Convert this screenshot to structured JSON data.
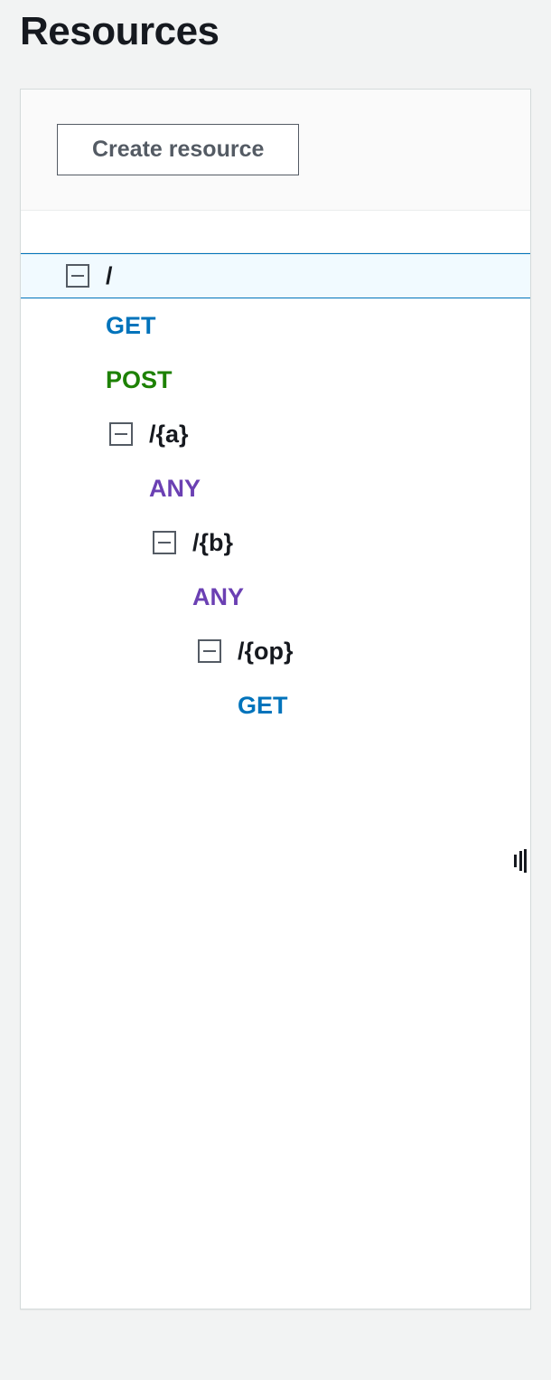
{
  "title": "Resources",
  "buttons": {
    "create_resource": "Create resource"
  },
  "tree": {
    "root": {
      "path": "/",
      "methods": [
        "GET",
        "POST"
      ],
      "children": {
        "a": {
          "path": "/{a}",
          "methods": [
            "ANY"
          ],
          "children": {
            "b": {
              "path": "/{b}",
              "methods": [
                "ANY"
              ],
              "children": {
                "op": {
                  "path": "/{op}",
                  "methods": [
                    "GET"
                  ]
                }
              }
            }
          }
        }
      }
    }
  }
}
